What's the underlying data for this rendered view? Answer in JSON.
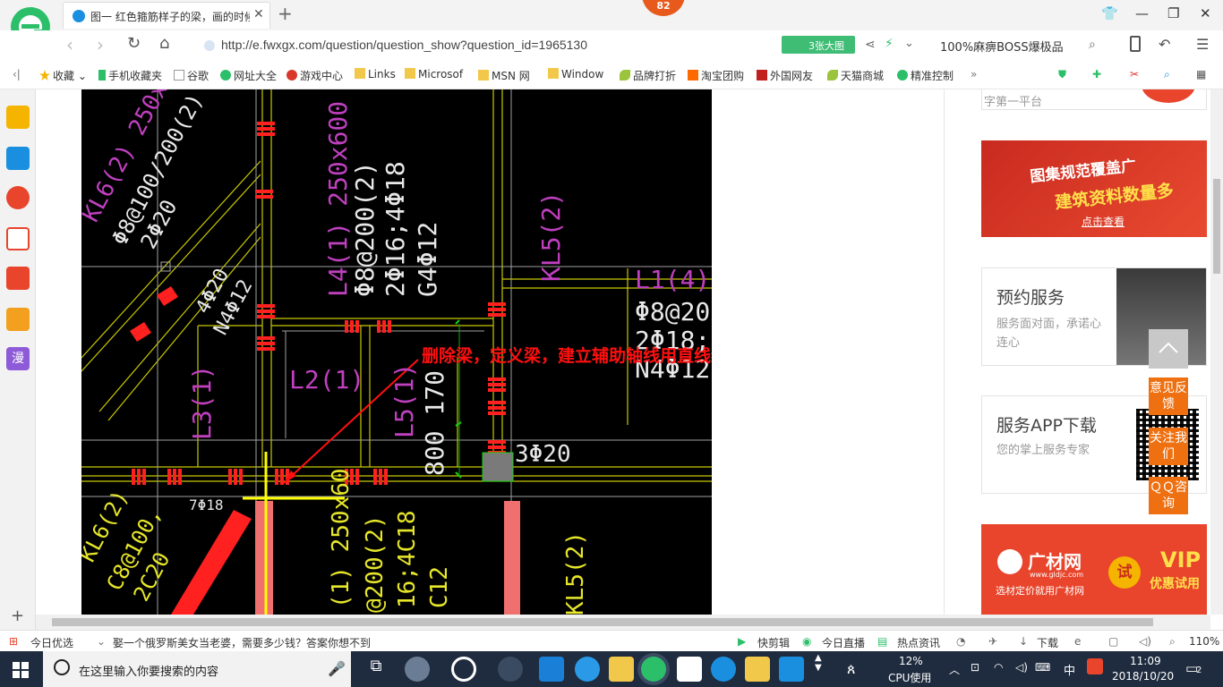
{
  "browser": {
    "tab_title": "图一 红色箍筋样子的梁，画的时候",
    "notification_count": "82",
    "url": "http://e.fwxgx.com/question/question_show?question_id=1965130",
    "big_image_label": "3张大图",
    "search_text": "100%麻痹BOSS爆极品"
  },
  "bookmarks": [
    {
      "label": "收藏",
      "icon": "star-icon"
    },
    {
      "label": "手机收藏夹",
      "icon": "phone-icon"
    },
    {
      "label": "谷歌",
      "icon": "page-icon"
    },
    {
      "label": "网址大全",
      "icon": "web-icon"
    },
    {
      "label": "游戏中心",
      "icon": "game-icon"
    },
    {
      "label": "Links",
      "icon": "folder-icon"
    },
    {
      "label": "Microsof",
      "icon": "folder-icon"
    },
    {
      "label": "MSN 网",
      "icon": "folder-icon"
    },
    {
      "label": "Window",
      "icon": "folder-icon"
    },
    {
      "label": "品牌打折",
      "icon": "leaf-icon"
    },
    {
      "label": "淘宝团购",
      "icon": "taobao-icon"
    },
    {
      "label": "外国网友",
      "icon": "flag-icon"
    },
    {
      "label": "天猫商城",
      "icon": "leaf-icon"
    },
    {
      "label": "精准控制",
      "icon": "wechat-icon"
    }
  ],
  "cad": {
    "annotation": "删除梁，定义梁，建立辅助轴线用直线绘制",
    "labels_upper": {
      "kl6": "KL6(2) 250x6",
      "kl6_stirrup": "Φ8@100/200(2)",
      "kl6_bars": "2Φ20",
      "l4": "L4(1) 250x600",
      "l4_stirrup": "Φ8@200(2)",
      "l4_bars": "2Φ16;4Φ18",
      "l4_side": "G4Φ12",
      "kl5": "KL5(2)",
      "l1": "L1(4)",
      "l1_stirrup": "Φ8@20",
      "l1_bars": "2Φ18;",
      "l1_side": "N4Φ12",
      "mid_bars": "4Φ20",
      "mid_side": "N4Φ12",
      "l2": "L2(1)",
      "l3": "L3(1)",
      "l5": "L5(1)",
      "l5_size": "800 170",
      "col_bars": "3Φ20",
      "bottom_cut": "7Φ18"
    },
    "labels_lower": {
      "kl6": "KL6(2)",
      "kl6_stirrup": "C8@100,",
      "kl6_bars": "2C20",
      "l4": "(1) 250x60",
      "l4_stirrup": "@200(2)",
      "l4_bars": "16;4C18",
      "l4_side": "C12",
      "kl5": "KL5(2)"
    }
  },
  "sidebar_right": {
    "banner1_line1": "图集规范覆盖广",
    "banner1_line2": "建筑资料数量多",
    "banner1_cta": "点击查看",
    "card1_title": "预约服务",
    "card1_desc": "服务面对面，承诺心连心",
    "card2_title": "服务APP下载",
    "card2_desc": "您的掌上服务专家",
    "banner2_brand": "广材网",
    "banner2_domain": "www.gldjc.com",
    "banner2_slogan": "选材定价就用广材网",
    "banner2_try": "试",
    "banner2_vip": "VIP",
    "banner2_vip_sub": "优惠试用",
    "top_card_fragment": "字第一平台"
  },
  "float_buttons": {
    "feedback": "意见反馈",
    "follow": "关注我们",
    "qq": "ＱＱ咨询"
  },
  "statusbar": {
    "today_pick": "今日优选",
    "news": "娶一个俄罗斯美女当老婆，需要多少钱？答案你想不到",
    "quick_clip": "快剪辑",
    "live": "今日直播",
    "hot_news": "热点资讯",
    "download": "下载",
    "zoom": "110%"
  },
  "taskbar": {
    "search_placeholder": "在这里输入你要搜索的内容",
    "cpu_percent": "12%",
    "cpu_label": "CPU使用",
    "ime": "中",
    "time": "11:09",
    "date": "2018/10/20",
    "notifications": "2"
  }
}
